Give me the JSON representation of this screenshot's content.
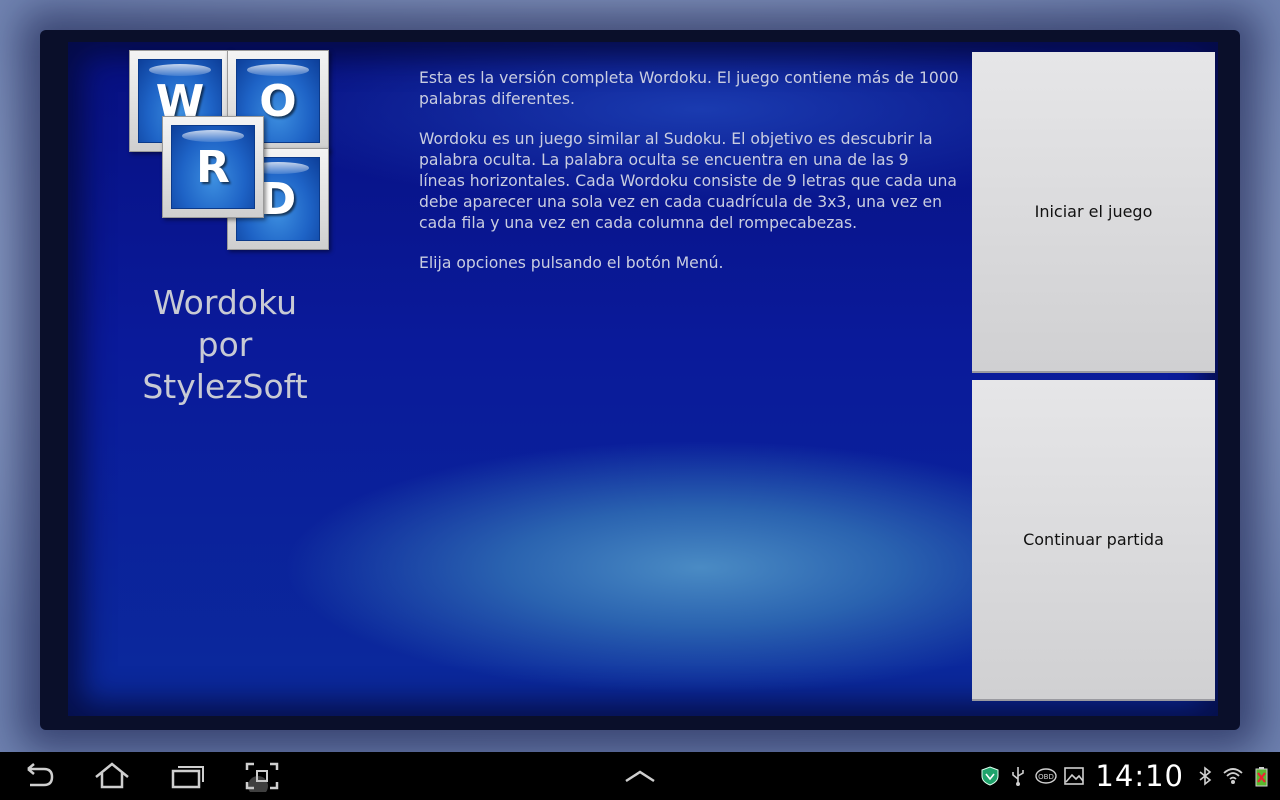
{
  "logo": {
    "letters": [
      "W",
      "O",
      "R",
      "D"
    ]
  },
  "app_title": {
    "line1": "Wordoku",
    "line2": "por",
    "line3": "StylezSoft"
  },
  "description": {
    "p1": "Esta es la versión completa Wordoku. El juego contiene más de 1000 palabras diferentes.",
    "p2": "Wordoku es un juego similar al Sudoku. El objetivo es descubrir la palabra oculta. La palabra oculta se encuentra en una de las 9 líneas horizontales. Cada Wordoku consiste de 9 letras que cada una debe aparecer una sola vez en cada cuadrícula de 3x3, una vez en cada fila y una vez en cada columna del rompecabezas.",
    "p3": "Elija opciones pulsando el botón Menú."
  },
  "buttons": {
    "start": "Iniciar el juego",
    "continue": "Continuar partida"
  },
  "status_bar": {
    "clock": "14:10",
    "icons": [
      "shield-icon",
      "usb-icon",
      "obd-icon",
      "image-icon",
      "bluetooth-icon",
      "wifi-icon",
      "battery-icon"
    ]
  },
  "nav_bar": {
    "icons": [
      "back-icon",
      "home-icon",
      "recent-apps-icon",
      "screenshot-icon",
      "app-drawer-up-icon"
    ]
  }
}
